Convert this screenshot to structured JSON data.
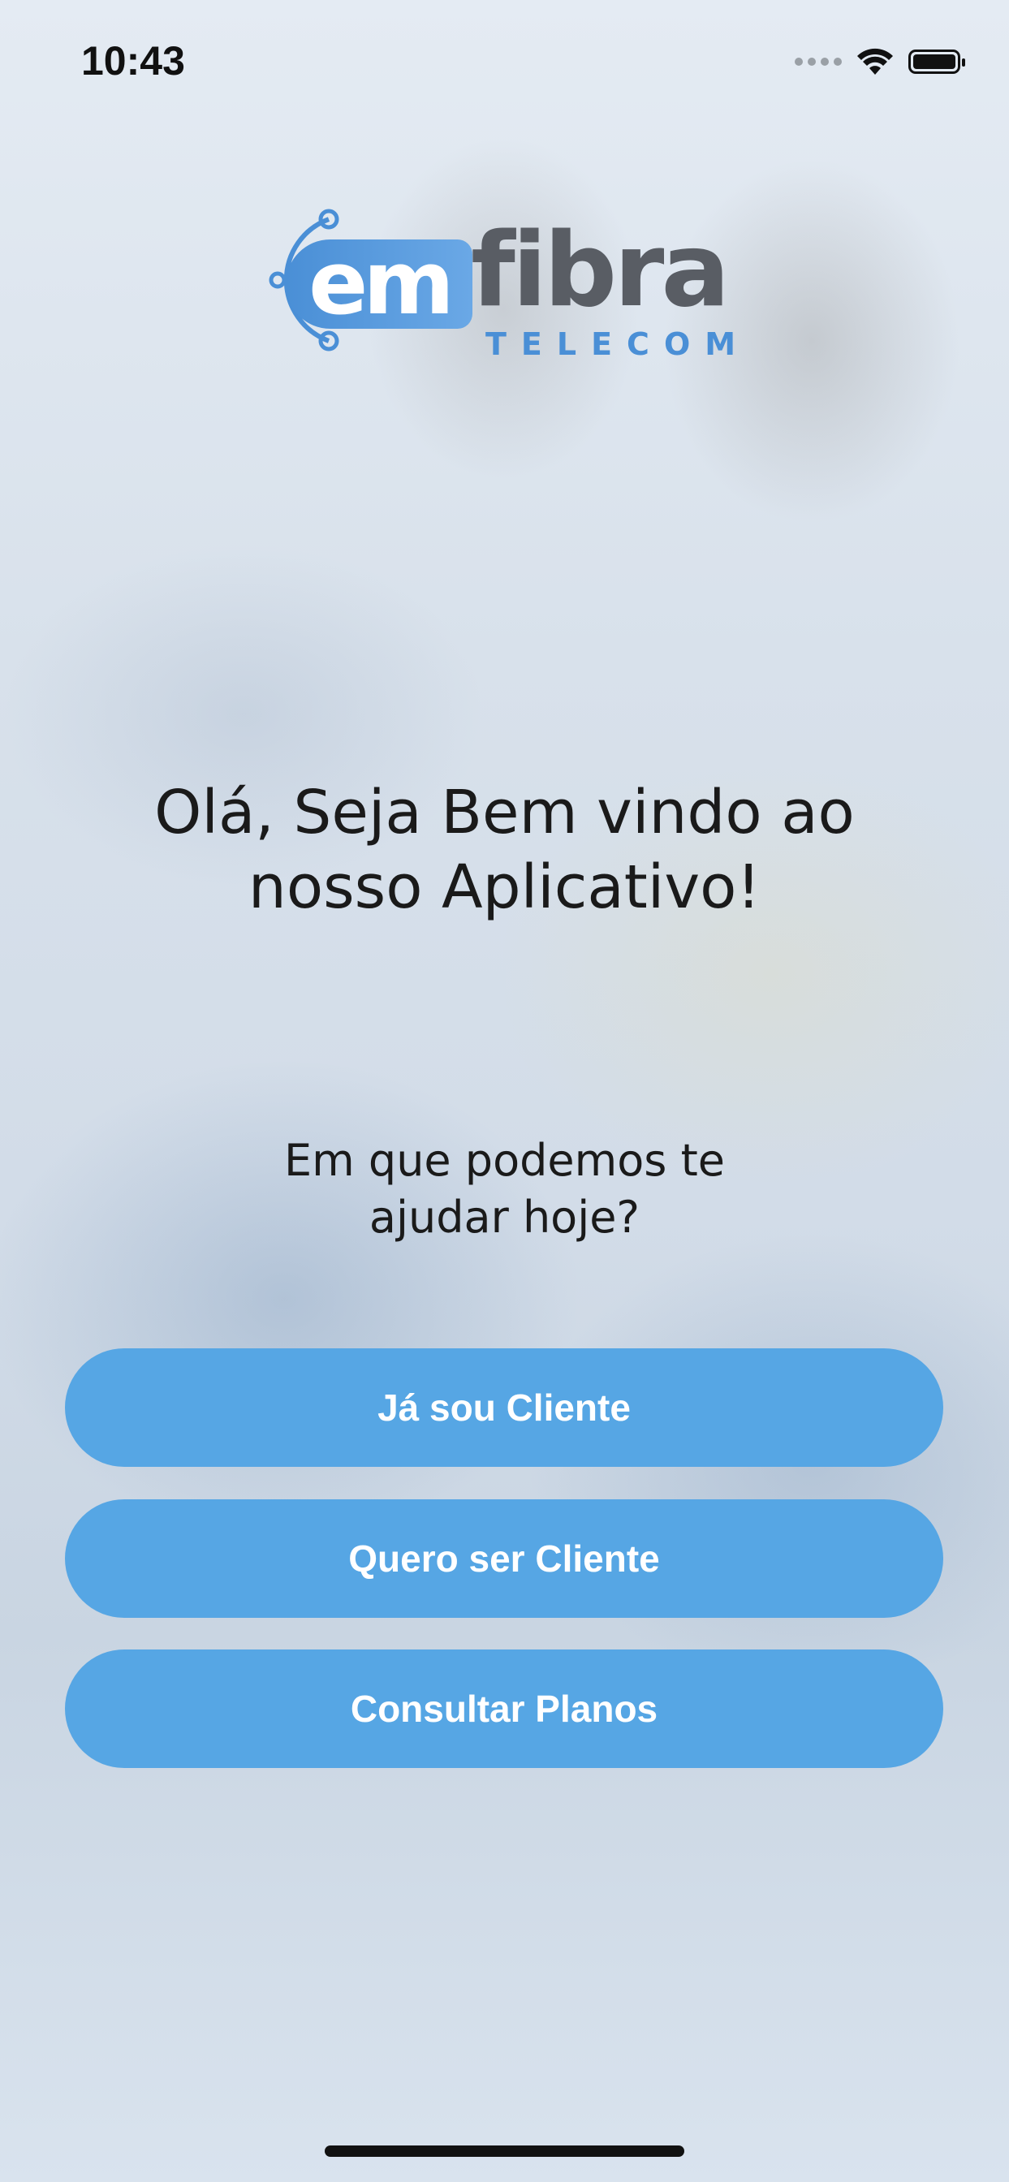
{
  "status_bar": {
    "time": "10:43",
    "icons": [
      "signal-dots-icon",
      "wifi-icon",
      "battery-icon"
    ]
  },
  "logo": {
    "em": "em",
    "fibra": "fibra",
    "telecom": "TELECOM",
    "colors": {
      "blue": "#4a8fd6",
      "gray": "#595d64"
    }
  },
  "welcome": {
    "line1": "Olá, Seja Bem vindo ao",
    "line2": "nosso Aplicativo!"
  },
  "question": {
    "line1": "Em que podemos te",
    "line2": "ajudar hoje?"
  },
  "buttons": [
    {
      "label": "Já sou Cliente"
    },
    {
      "label": "Quero ser Cliente"
    },
    {
      "label": "Consultar Planos"
    }
  ],
  "colors": {
    "button": "#56a6e4",
    "button_text": "#ffffff",
    "text": "#1a1a1a"
  }
}
